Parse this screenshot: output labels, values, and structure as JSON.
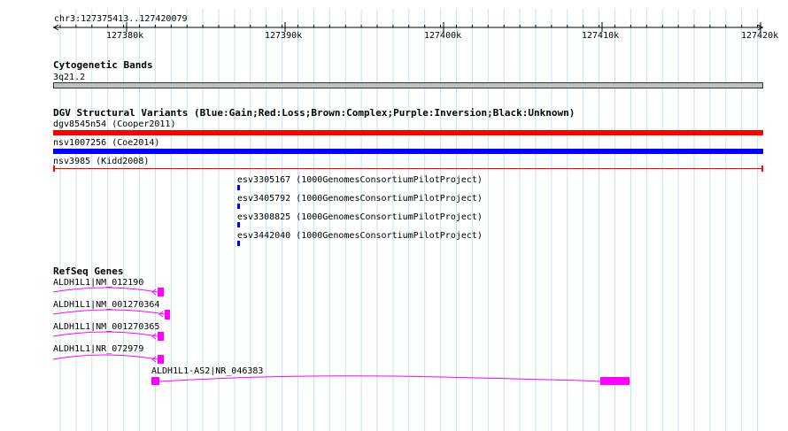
{
  "ruler": {
    "region": "chr3:127375413..127420079",
    "ticks": [
      "127380k",
      "127390k",
      "127400k",
      "127410k",
      "127420k"
    ]
  },
  "cytoband": {
    "title": "Cytogenetic Bands",
    "band": "3q21.2",
    "color": "#c0c0c0"
  },
  "dgv": {
    "title": "DGV Structural Variants (Blue:Gain;Red:Loss;Brown:Complex;Purple:Inversion;Black:Unknown)",
    "colors": {
      "loss": "#ff0000",
      "gain": "#0000ff"
    },
    "variants": [
      {
        "label": "dgv8545n54 (Cooper2011)",
        "type": "loss"
      },
      {
        "label": "nsv1007256 (Coe2014)",
        "type": "gain"
      },
      {
        "label": "nsv3985 (Kidd2008)",
        "type": "loss"
      },
      {
        "label": "esv3305167 (1000GenomesConsortiumPilotProject)",
        "type": "gain"
      },
      {
        "label": "esv3405792 (1000GenomesConsortiumPilotProject)",
        "type": "gain"
      },
      {
        "label": "esv3308825 (1000GenomesConsortiumPilotProject)",
        "type": "gain"
      },
      {
        "label": "esv3442040 (1000GenomesConsortiumPilotProject)",
        "type": "gain"
      }
    ]
  },
  "refseq": {
    "title": "RefSeq Genes",
    "color": "#ff00ff",
    "genes": [
      {
        "label": "ALDH1L1|NM_012190"
      },
      {
        "label": "ALDH1L1|NM_001270364"
      },
      {
        "label": "ALDH1L1|NM_001270365"
      },
      {
        "label": "ALDH1L1|NR_072979"
      },
      {
        "label": "ALDH1L1-AS2|NR_046383"
      }
    ]
  }
}
